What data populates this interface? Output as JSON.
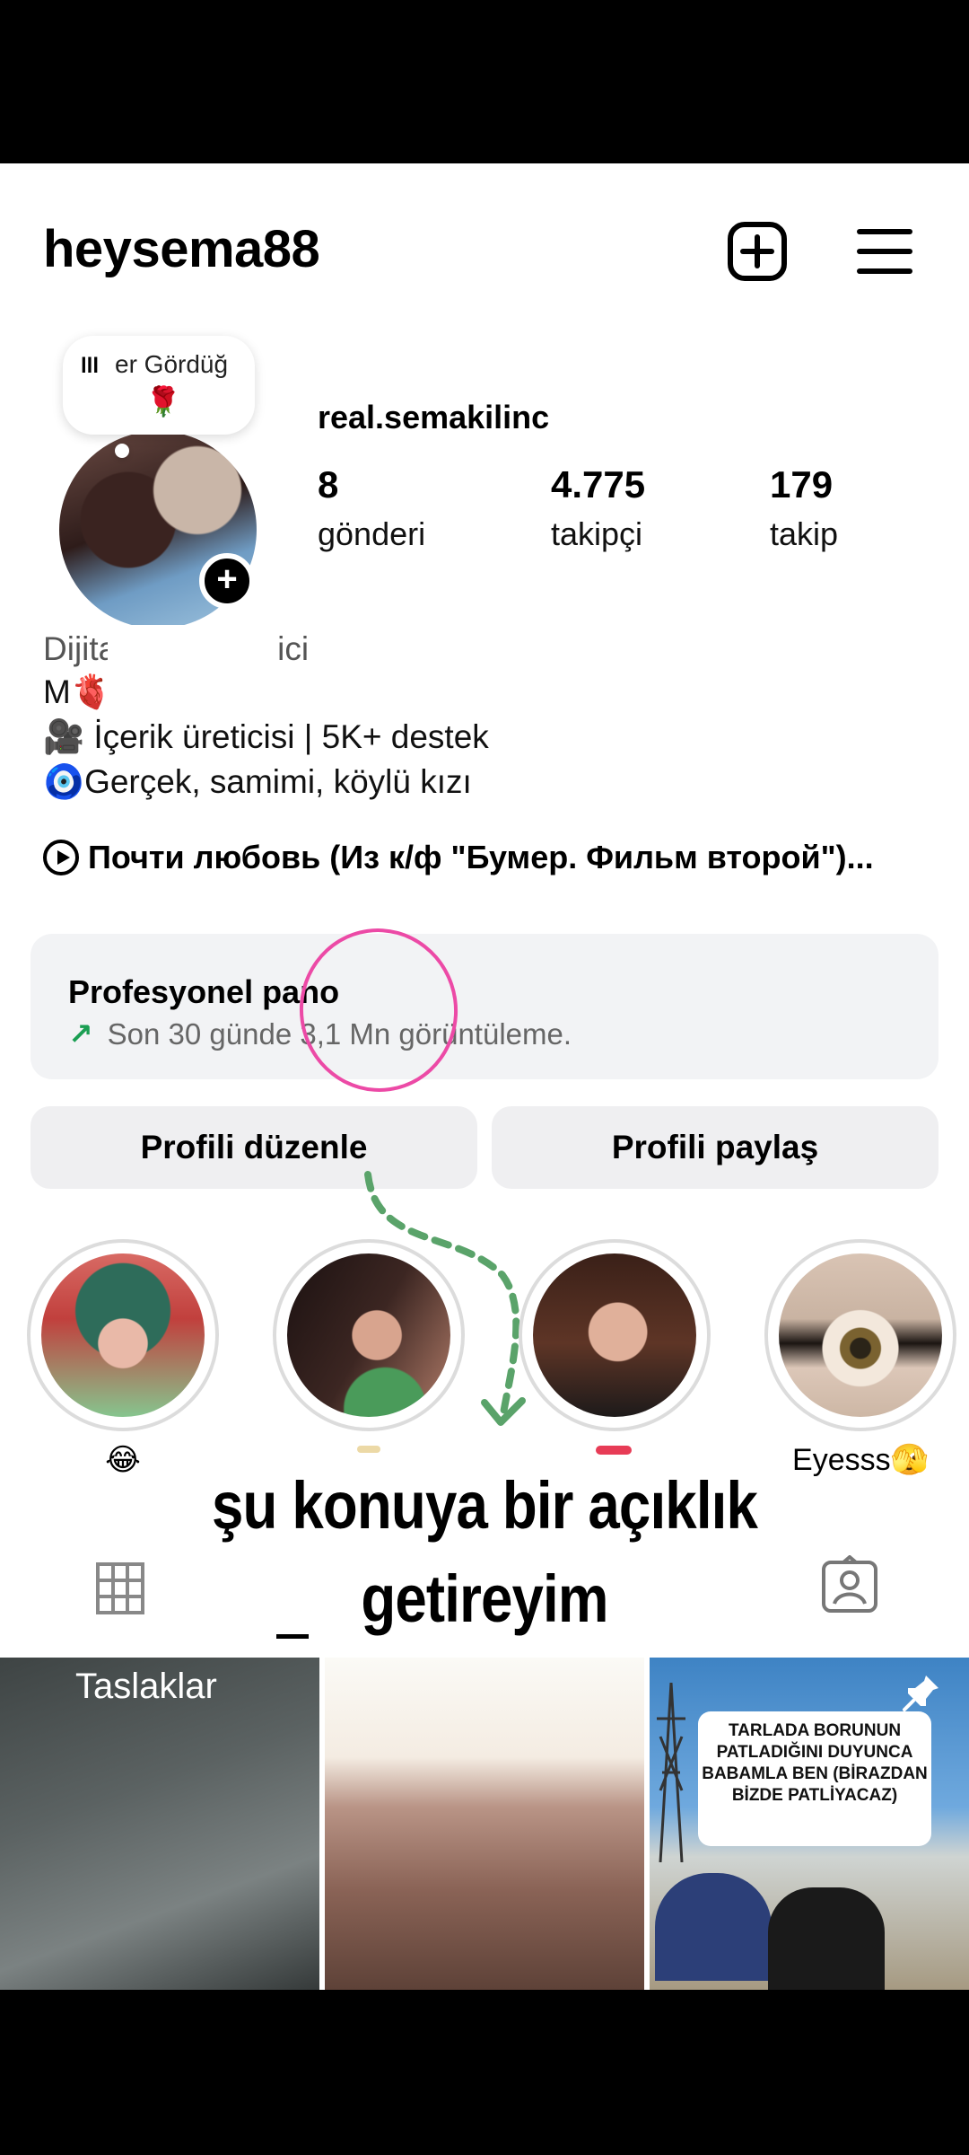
{
  "header": {
    "username": "heysema88"
  },
  "note": {
    "bars": "lll",
    "text": "er Gördüğ",
    "emoji": "🌹"
  },
  "profile": {
    "avatar_plus": "+",
    "real_name": "real.semakilinc",
    "stats": [
      {
        "value": "8",
        "label": "gönderi"
      },
      {
        "value": "4.775",
        "label": "takipçi"
      },
      {
        "value": "179",
        "label": "takip"
      }
    ]
  },
  "bio": {
    "category": "Dijital içerik üretici",
    "line1": "M🫀",
    "line2": "🎥 İçerik üreticisi | 5K+ destek",
    "line3": "🧿Gerçek, samimi, köylü kızı",
    "music": "Почти любовь (Из к/ф \"Бумер. Фильм второй\")..."
  },
  "pro_dashboard": {
    "title": "Profesyonel pano",
    "subtitle": "Son 30 günde 3,1 Mn görüntüleme.",
    "arrow": "↗"
  },
  "buttons": {
    "edit": "Profili düzenle",
    "share": "Profili paylaş"
  },
  "highlights": [
    {
      "label": "😂"
    },
    {
      "label": ""
    },
    {
      "label": ""
    },
    {
      "label": "Eyesss🫣"
    }
  ],
  "caption": {
    "line1": "şu konuya bir açıklık",
    "line2": "getireyim"
  },
  "grid": {
    "drafts_label": "Taslaklar",
    "post3_text": "TARLADA BORUNUN PATLADIĞINI DUYUNCA BABAMLA BEN (BİRAZDAN BİZDE PATLİYACAZ)"
  },
  "colors": {
    "accent_green": "#1a9e52",
    "annotation_pink": "#ec4aa6",
    "annotation_green": "#5aa36a"
  }
}
